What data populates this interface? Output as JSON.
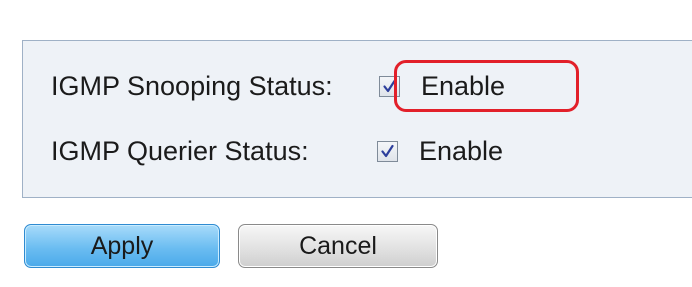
{
  "igmp_settings": {
    "snooping": {
      "label": "IGMP Snooping Status:",
      "option_text": "Enable",
      "checked": true
    },
    "querier": {
      "label": "IGMP Querier Status:",
      "option_text": "Enable",
      "checked": true
    }
  },
  "buttons": {
    "apply_label": "Apply",
    "cancel_label": "Cancel"
  },
  "colors": {
    "panel_background": "#eef2f7",
    "panel_border": "#9fb1c6",
    "highlight_annotation": "#e2202a",
    "apply_button": "#6bbdf1",
    "checkmark": "#2d3f9c"
  },
  "annotation": {
    "highlighted_item": "snooping-enable"
  }
}
